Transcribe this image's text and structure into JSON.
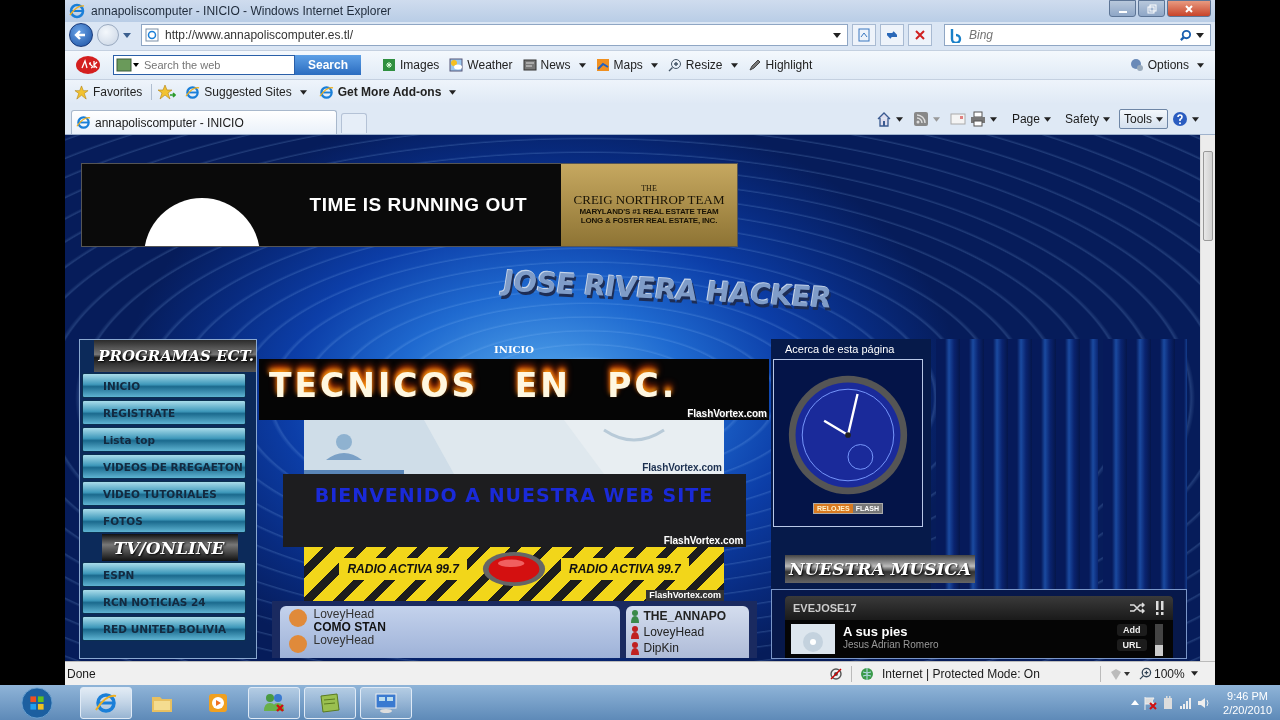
{
  "window": {
    "title": "annapoliscomputer - INICIO - Windows Internet Explorer"
  },
  "address_bar": {
    "url": "http://www.annapoliscomputer.es.tl/"
  },
  "search_box": {
    "placeholder": "Bing"
  },
  "ask_toolbar": {
    "search_placeholder": "Search the web",
    "search_button": "Search",
    "options": "Options",
    "buttons": [
      {
        "label": "Images",
        "dropdown": false
      },
      {
        "label": "Weather",
        "dropdown": false
      },
      {
        "label": "News",
        "dropdown": true
      },
      {
        "label": "Maps",
        "dropdown": true
      },
      {
        "label": "Resize",
        "dropdown": true
      },
      {
        "label": "Highlight",
        "dropdown": false
      }
    ]
  },
  "favorites_bar": {
    "favorites": "Favorites",
    "items": [
      {
        "label": "Suggested Sites",
        "emphasized": false,
        "dropdown": true
      },
      {
        "label": "Get More Add-ons",
        "emphasized": true,
        "dropdown": true
      }
    ]
  },
  "tabs": [
    {
      "label": "annapoliscomputer - INICIO",
      "selected": true
    }
  ],
  "command_bar": {
    "buttons": [
      {
        "label": "Page",
        "hovered": false
      },
      {
        "label": "Safety",
        "hovered": false
      },
      {
        "label": "Tools",
        "hovered": true
      }
    ]
  },
  "page": {
    "ad": {
      "headline": "TIME IS RUNNING OUT",
      "brand_top": "THE",
      "brand": "CREIG NORTHROP TEAM",
      "tagline": "MARYLAND'S #1 REAL ESTATE TEAM",
      "company": "LONG & FOSTER REAL ESTATE, INC."
    },
    "site_title": "JOSE RIVERA HACKER",
    "nav": [
      {
        "kind": "header",
        "label": "PROGRAMAS ECT."
      },
      {
        "kind": "link",
        "label": "INICIO"
      },
      {
        "kind": "link",
        "label": "REGISTRATE"
      },
      {
        "kind": "link",
        "label": "Lista top"
      },
      {
        "kind": "link",
        "label": "VIDEOS DE RREGAETON"
      },
      {
        "kind": "link",
        "label": "VIDEO TUTORIALES"
      },
      {
        "kind": "link",
        "label": "FOTOS"
      },
      {
        "kind": "header",
        "label": "TV/ONLINE"
      },
      {
        "kind": "link",
        "label": "ESPN"
      },
      {
        "kind": "link",
        "label": "RCN NOTICIAS 24"
      },
      {
        "kind": "link",
        "label": "RED UNITED BOLIVIA"
      }
    ],
    "breadcrumb": "INICIO",
    "fire_banner": {
      "text": "TECNICOS EN PC.",
      "credit": "FlashVortex.com"
    },
    "map_banner": {
      "credit": "FlashVortex.com"
    },
    "welcome_banner": {
      "text": "BIENVENIDO A NUESTRA WEB SITE",
      "credit": "FlashVortex.com"
    },
    "radio_banner": {
      "labels": [
        "RADIO ACTIVA 99.7",
        "RADIO ACTIVA 99.7"
      ],
      "credit": "FlashVortex.com"
    },
    "chat": {
      "messages": [
        {
          "user": "LoveyHead",
          "text": "COMO STAN"
        },
        {
          "user": "LoveyHead"
        }
      ],
      "users": [
        {
          "name": "THE_ANNAPO",
          "color": "#3a8a4a"
        },
        {
          "name": "LoveyHead",
          "color": "#c02020"
        },
        {
          "name": "DipKin",
          "color": "#c02020"
        }
      ]
    },
    "about": {
      "title": "Acerca de esta página",
      "badge_left": "RELOJES",
      "badge_right": "FLASH"
    },
    "music": {
      "title": "NUESTRA MUSICA",
      "user": "EVEJOSE17",
      "song": "A sus pies",
      "artist": "Jesus Adrian Romero",
      "add": "Add",
      "url": "URL",
      "volume": {
        "level": 0.35
      }
    }
  },
  "status_bar": {
    "text": "Done",
    "zone": "Internet | Protected Mode: On",
    "zoom": "100%"
  },
  "taskbar": {
    "apps": [
      {
        "running": true,
        "active": true
      },
      {
        "running": false,
        "active": false
      },
      {
        "running": false,
        "active": false
      },
      {
        "running": true,
        "active": false
      },
      {
        "running": true,
        "active": false
      },
      {
        "running": true,
        "active": false
      }
    ],
    "time": "9:46 PM",
    "date": "2/20/2010"
  }
}
